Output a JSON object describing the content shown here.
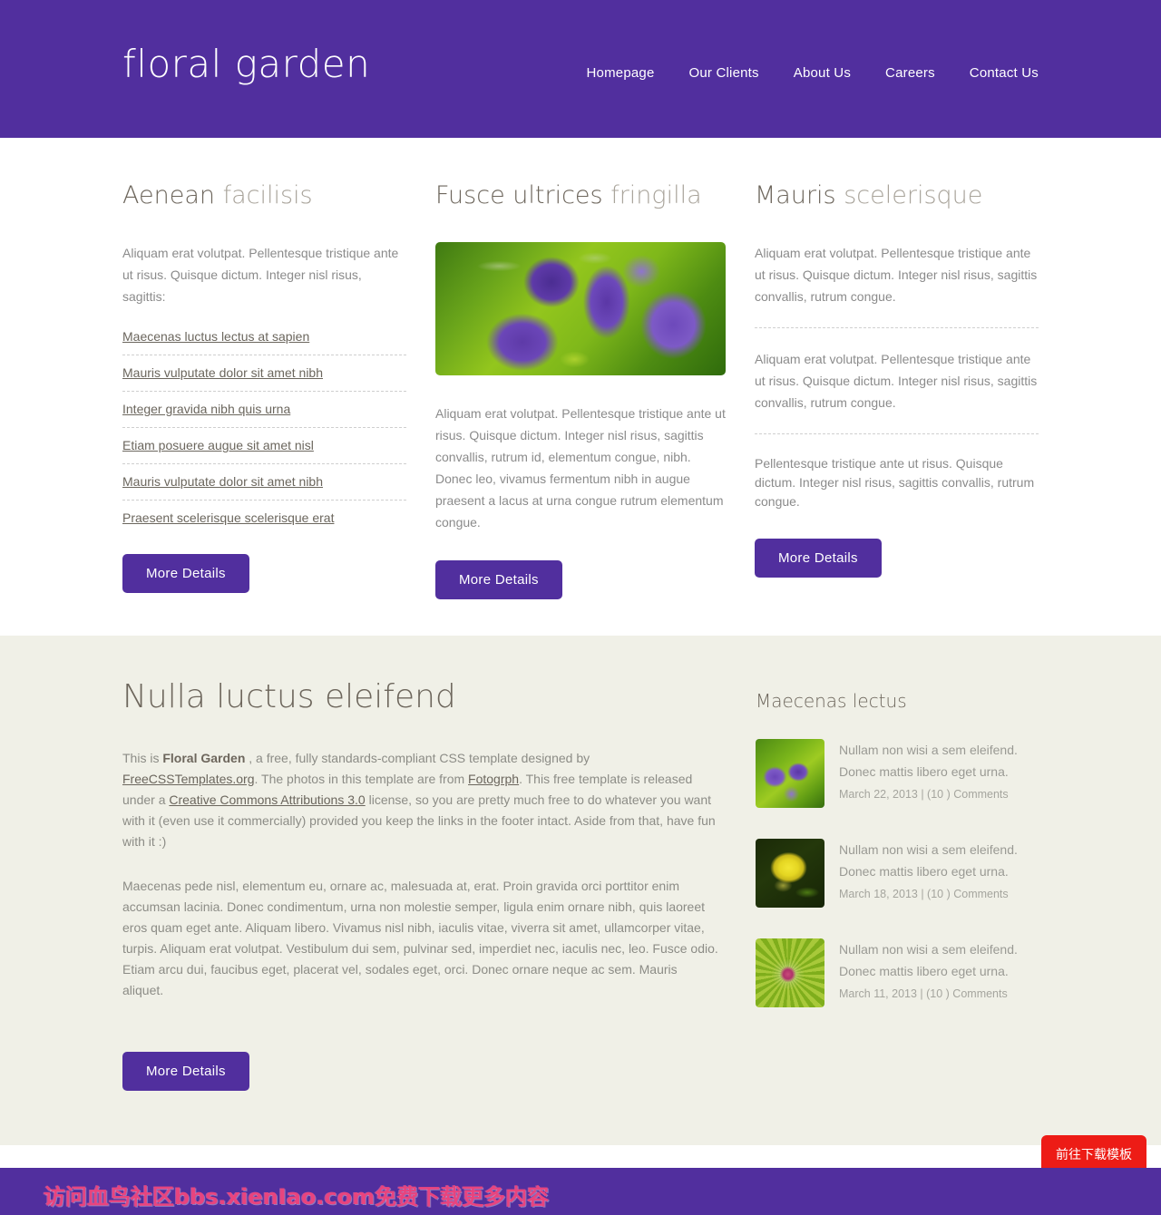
{
  "colors": {
    "brand_purple": "#512F9E",
    "cream": "#F0F0E7",
    "heading_dark": "#6D665C",
    "heading_light": "#A9A49B",
    "body_gray": "#8B8B8B",
    "red_button": "#ED1C16",
    "watermark_pink": "#E8447E"
  },
  "header": {
    "logo": "floral garden",
    "nav": [
      {
        "label": "Homepage"
      },
      {
        "label": "Our Clients"
      },
      {
        "label": "About Us"
      },
      {
        "label": "Careers"
      },
      {
        "label": "Contact Us"
      }
    ]
  },
  "columns": [
    {
      "heading_strong": "Aenean ",
      "heading_light": "facilisis",
      "intro": "Aliquam erat volutpat. Pellentesque tristique ante ut risus. Quisque dictum. Integer nisl risus, sagittis:",
      "links": [
        "Maecenas luctus lectus at sapien",
        "Mauris vulputate dolor sit amet nibh",
        "Integer gravida nibh quis urna",
        "Etiam posuere augue sit amet nisl",
        "Mauris vulputate dolor sit amet nibh",
        "Praesent scelerisque scelerisque erat"
      ],
      "button": "More Details"
    },
    {
      "heading_strong": "Fusce ultrices ",
      "heading_light": "fringilla",
      "image_name": "purple-flowers-photo",
      "body": "Aliquam erat volutpat. Pellentesque tristique ante ut risus. Quisque dictum. Integer nisl risus, sagittis convallis, rutrum id, elementum congue, nibh. Donec leo, vivamus fermentum nibh in augue praesent a lacus at urna congue rutrum elementum congue.",
      "button": "More Details"
    },
    {
      "heading_strong": "Mauris ",
      "heading_light": "scelerisque",
      "paragraphs": [
        "Aliquam erat volutpat. Pellentesque tristique ante ut risus. Quisque dictum. Integer nisl risus, sagittis convallis, rutrum congue.",
        "Aliquam erat volutpat. Pellentesque tristique ante ut risus. Quisque dictum. Integer nisl risus, sagittis convallis, rutrum congue.",
        "Pellentesque tristique ante ut risus. Quisque dictum. Integer nisl risus, sagittis convallis, rutrum congue."
      ],
      "button": "More Details"
    }
  ],
  "lower": {
    "heading": "Nulla luctus eleifend",
    "para1": {
      "t1": "This is ",
      "brand": "Floral Garden",
      "t2": " , a free, fully standards-compliant CSS template designed by ",
      "link1": "FreeCSSTemplates.org",
      "t3": ". The photos in this template are from ",
      "link2": "Fotogrph",
      "t4": ". This free template is released under a ",
      "link3": "Creative Commons Attributions 3.0",
      "t5": " license, so you are pretty much free to do whatever you want with it (even use it commercially) provided you keep the links in the footer intact. Aside from that, have fun with it :)"
    },
    "para2": "Maecenas pede nisl, elementum eu, ornare ac, malesuada at, erat. Proin gravida orci porttitor enim accumsan lacinia. Donec condimentum, urna non molestie semper, ligula enim ornare nibh, quis laoreet eros quam eget ante. Aliquam libero. Vivamus nisl nibh, iaculis vitae, viverra sit amet, ullamcorper vitae, turpis. Aliquam erat volutpat. Vestibulum dui sem, pulvinar sed, imperdiet nec, iaculis nec, leo. Fusce odio. Etiam arcu dui, faucibus eget, placerat vel, sodales eget, orci. Donec ornare neque ac sem. Mauris aliquet.",
    "button": "More Details"
  },
  "sidebar": {
    "heading": "Maecenas lectus",
    "items": [
      {
        "thumb_name": "purple-flower-thumb",
        "desc": "Nullam non wisi a sem eleifend. Donec mattis libero eget urna.",
        "meta": "March 22, 2013 | (10 ) Comments"
      },
      {
        "thumb_name": "yellow-marigold-thumb",
        "desc": "Nullam non wisi a sem eleifend. Donec mattis libero eget urna.",
        "meta": "March 18, 2013 | (10 ) Comments"
      },
      {
        "thumb_name": "green-thistle-thumb",
        "desc": "Nullam non wisi a sem eleifend. Donec mattis libero eget urna.",
        "meta": "March 11, 2013 | (10 ) Comments"
      }
    ]
  },
  "overlay": {
    "download_button": "前往下载模板",
    "watermark": "访问血鸟社区bbs.xienIao.com免费下载更多内容"
  }
}
